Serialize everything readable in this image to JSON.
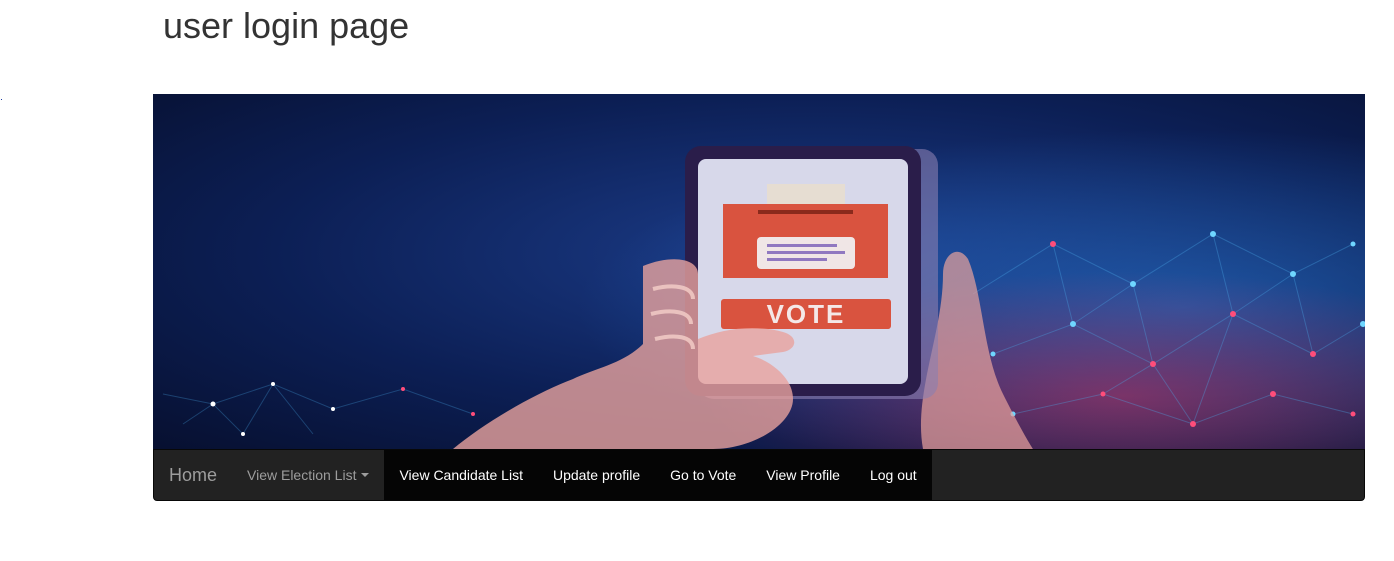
{
  "page": {
    "title": "user login page"
  },
  "banner": {
    "alt": "voting banner",
    "vote_label": "VOTE",
    "colors": {
      "background": "#081333",
      "accent_red": "#d9533f",
      "phone_frame": "#2a1d4a",
      "hand": "#e8a39d"
    }
  },
  "navbar": {
    "brand": "Home",
    "dropdown_label": "View Election List",
    "links": [
      {
        "label": "View Candidate List"
      },
      {
        "label": "Update profile"
      },
      {
        "label": "Go to Vote"
      },
      {
        "label": "View Profile"
      },
      {
        "label": "Log out"
      }
    ]
  }
}
